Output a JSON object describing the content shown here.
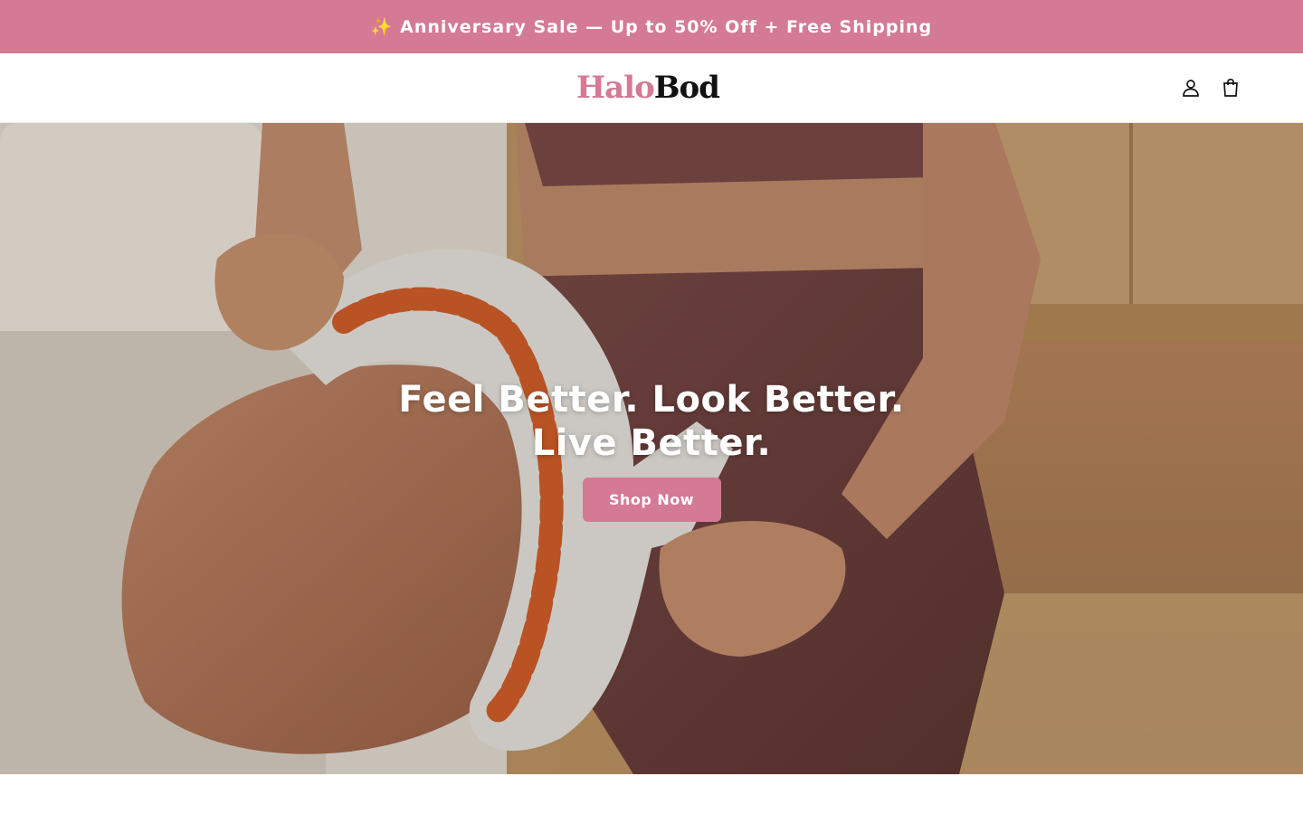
{
  "announcement": {
    "text": "✨ Anniversary Sale — Up to 50% Off + Free Shipping"
  },
  "header": {
    "logo_part_1": "Halo",
    "logo_part_2": "Bod",
    "icons": [
      "account-icon",
      "cart-icon"
    ]
  },
  "hero": {
    "title": "Feel Better. Look Better. Live Better.",
    "cta_label": "Shop Now"
  },
  "colors": {
    "brand_pink": "#d47a95",
    "text_dark": "#111111",
    "background": "#ffffff"
  }
}
